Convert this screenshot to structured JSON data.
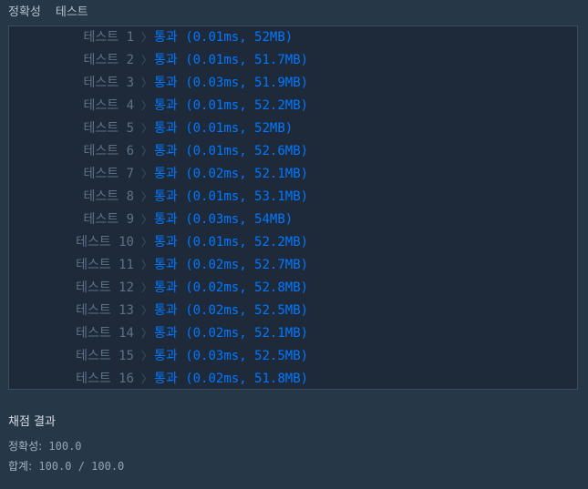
{
  "tabs": [
    "정확성",
    "테스트"
  ],
  "results": [
    {
      "label": "테스트 1",
      "value": "통과 (0.01ms, 52MB)"
    },
    {
      "label": "테스트 2",
      "value": "통과 (0.01ms, 51.7MB)"
    },
    {
      "label": "테스트 3",
      "value": "통과 (0.03ms, 51.9MB)"
    },
    {
      "label": "테스트 4",
      "value": "통과 (0.01ms, 52.2MB)"
    },
    {
      "label": "테스트 5",
      "value": "통과 (0.01ms, 52MB)"
    },
    {
      "label": "테스트 6",
      "value": "통과 (0.01ms, 52.6MB)"
    },
    {
      "label": "테스트 7",
      "value": "통과 (0.02ms, 52.1MB)"
    },
    {
      "label": "테스트 8",
      "value": "통과 (0.01ms, 53.1MB)"
    },
    {
      "label": "테스트 9",
      "value": "통과 (0.03ms, 54MB)"
    },
    {
      "label": "테스트 10",
      "value": "통과 (0.01ms, 52.2MB)"
    },
    {
      "label": "테스트 11",
      "value": "통과 (0.02ms, 52.7MB)"
    },
    {
      "label": "테스트 12",
      "value": "통과 (0.02ms, 52.8MB)"
    },
    {
      "label": "테스트 13",
      "value": "통과 (0.02ms, 52.5MB)"
    },
    {
      "label": "테스트 14",
      "value": "통과 (0.02ms, 52.1MB)"
    },
    {
      "label": "테스트 15",
      "value": "통과 (0.03ms, 52.5MB)"
    },
    {
      "label": "테스트 16",
      "value": "통과 (0.02ms, 51.8MB)"
    }
  ],
  "summary": {
    "title": "채점 결과",
    "accuracy_label": "정확성:",
    "accuracy_value": "100.0",
    "total_label": "합계:",
    "total_value": "100.0 / 100.0"
  },
  "colors": {
    "background": "#263747",
    "panel": "#1E2A3A",
    "pass_text": "#0078FF",
    "label_text": "#5F7186"
  }
}
